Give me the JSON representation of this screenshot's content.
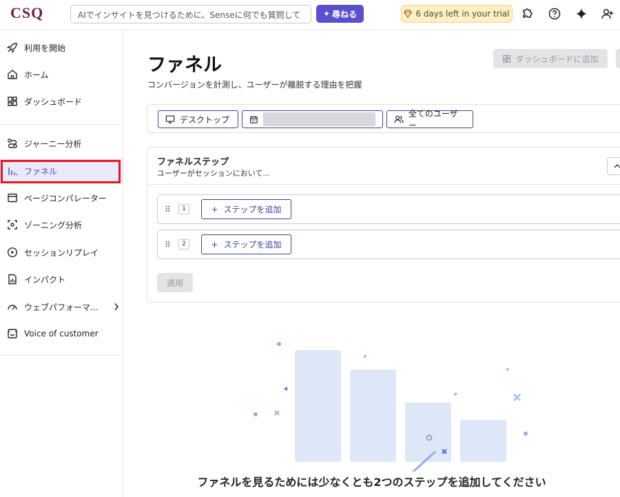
{
  "topbar": {
    "logo": "CSQ",
    "search_placeholder": "AIでインサイトを見つけるために、Senseに何でも質問して",
    "ask_label": "尋ねる",
    "trial_label": "6 days left in your trial",
    "icons": [
      "puzzle-icon",
      "help-icon",
      "sparkle-icon",
      "add-user-icon"
    ]
  },
  "sidebar": {
    "items": [
      {
        "label": "利用を開始",
        "icon": "rocket-icon"
      },
      {
        "label": "ホーム",
        "icon": "home-icon"
      },
      {
        "label": "ダッシュボード",
        "icon": "dashboard-icon"
      },
      {
        "label": "ジャーニー分析",
        "icon": "journey-icon"
      },
      {
        "label": "ファネル",
        "icon": "funnel-icon",
        "active": true
      },
      {
        "label": "ページコンパレーター",
        "icon": "page-icon"
      },
      {
        "label": "ゾーニング分析",
        "icon": "zoning-icon"
      },
      {
        "label": "セッションリプレイ",
        "icon": "play-icon"
      },
      {
        "label": "インパクト",
        "icon": "impact-icon"
      },
      {
        "label": "ウェブパフォーマ…",
        "icon": "gauge-icon"
      },
      {
        "label": "Voice of customer",
        "icon": "feedback-icon"
      }
    ]
  },
  "main": {
    "title": "ファネル",
    "subtitle": "コンバージョンを計測し、ユーザーが離脱する理由を把握",
    "add_dashboard_label": "ダッシュボードに追加",
    "filters": {
      "device_label": "デスクトップ",
      "users_label": "全てのユーザー"
    },
    "steps": {
      "title": "ファネルステップ",
      "description": "ユーザーがセッションにおいて...",
      "rows": [
        {
          "number": "1",
          "add_label": "ステップを追加"
        },
        {
          "number": "2",
          "add_label": "ステップを追加"
        }
      ],
      "apply_label": "適用"
    },
    "empty_message": "ファネルを見るためには少なくとも2つのステップを追加してください"
  },
  "colors": {
    "accent": "#5a4fcf",
    "highlight": "#e4161f",
    "trial_bg": "#fdefc8"
  }
}
